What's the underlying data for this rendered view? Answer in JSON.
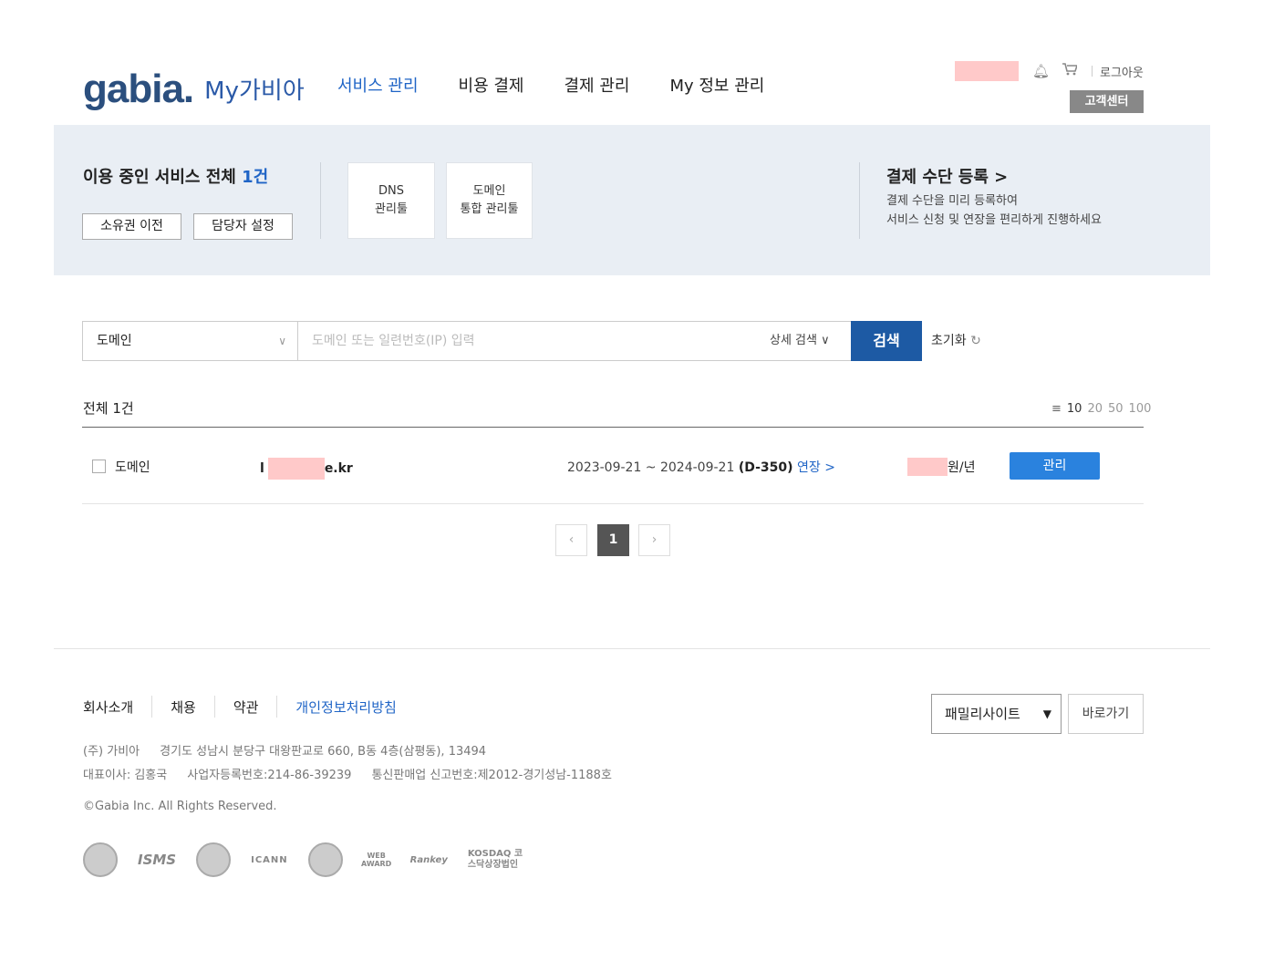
{
  "header": {
    "logo_text": "gabia.",
    "logo_sub": "My가비아",
    "nav": [
      {
        "label": "서비스 관리",
        "active": true
      },
      {
        "label": "비용 결제",
        "active": false
      },
      {
        "label": "결제 관리",
        "active": false
      },
      {
        "label": "My 정보 관리",
        "active": false
      }
    ],
    "logout": "로그아웃",
    "customer_center": "고객센터"
  },
  "summary": {
    "title_prefix": "이용 중인 서비스 전체 ",
    "title_count": "1건",
    "transfer_button": "소유권 이전",
    "contact_button": "담당자 설정",
    "tools": [
      {
        "line1": "DNS",
        "line2": "관리툴"
      },
      {
        "line1": "도메인",
        "line2": "통합 관리툴"
      }
    ],
    "payment_title": "결제 수단 등록 >",
    "payment_desc1": "결제 수단을 미리 등록하여",
    "payment_desc2": "서비스 신청 및 연장을 편리하게 진행하세요"
  },
  "search": {
    "category": "도메인",
    "placeholder": "도메인 또는 일련번호(IP) 입력",
    "advanced": "상세 검색",
    "button": "검색",
    "reset": "초기화"
  },
  "list": {
    "total": "전체 1건",
    "page_sizes": [
      "10",
      "20",
      "50",
      "100"
    ],
    "rows": [
      {
        "type": "도메인",
        "domain_prefix": "l",
        "domain_suffix": "e.kr",
        "period": "2023-09-21 ~ 2024-09-21",
        "dday": "(D-350)",
        "extend": "연장 >",
        "price_suffix": "원/년",
        "manage": "관리"
      }
    ]
  },
  "pagination": {
    "prev": "‹",
    "current": "1",
    "next": "›"
  },
  "footer": {
    "links": [
      "회사소개",
      "채용",
      "약관",
      "개인정보처리방침"
    ],
    "family_site": "패밀리사이트",
    "goto": "바로가기",
    "line1": [
      "(주) 가비아",
      "경기도 성남시 분당구 대왕판교로 660, B동 4층(삼평동), 13494"
    ],
    "line2": [
      "대표이사: 김홍국",
      "사업자등록번호:214-86-39239",
      "통신판매업 신고번호:제2012-경기성남-1188호"
    ],
    "copyright": "©Gabia Inc. All Rights Reserved.",
    "badges": [
      "ISMS",
      "ICANN",
      "WEB AWARD",
      "Rankey",
      "KOSDAQ 코스닥상장법인"
    ]
  },
  "colors": {
    "accent": "#1f64c6",
    "search_button": "#1d5aa4",
    "manage_button": "#2a82de",
    "panel_bg": "#e9eef4"
  }
}
